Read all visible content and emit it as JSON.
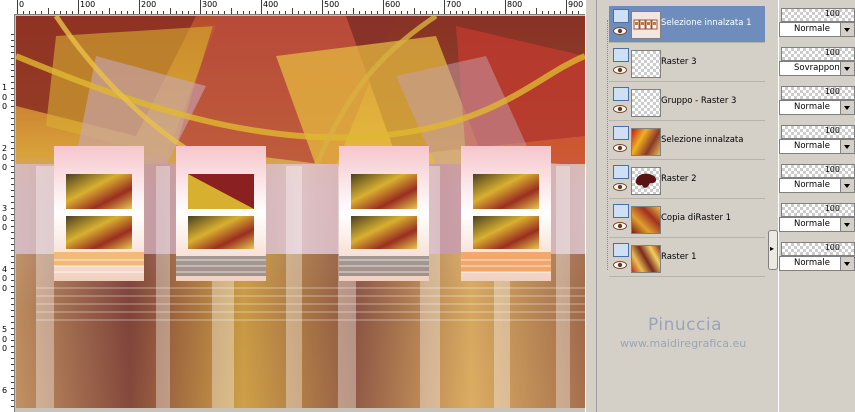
{
  "ruler": {
    "top_numbers": [
      "0",
      "100",
      "200",
      "300",
      "400",
      "500",
      "600",
      "700",
      "800",
      "900"
    ],
    "left_numbers": [
      "1",
      "0",
      "0",
      "2",
      "0",
      "0",
      "3",
      "0",
      "0",
      "4",
      "0",
      "0",
      "5",
      "0",
      "0",
      "6"
    ]
  },
  "layers": [
    {
      "name": "Selezione innalzata 1",
      "selected": true,
      "thumb": "t-sel1"
    },
    {
      "name": "Raster 3",
      "selected": false,
      "thumb": "t-empty"
    },
    {
      "name": "Gruppo - Raster 3",
      "selected": false,
      "thumb": "t-empty"
    },
    {
      "name": "Selezione innalzata",
      "selected": false,
      "thumb": "t-sel2"
    },
    {
      "name": "Raster 2",
      "selected": false,
      "thumb": "t-r2"
    },
    {
      "name": "Copia diRaster 1",
      "selected": false,
      "thumb": "t-copy"
    },
    {
      "name": "Raster 1",
      "selected": false,
      "thumb": "t-r1"
    }
  ],
  "properties": [
    {
      "opacity": "100",
      "blend_mode": "Normale"
    },
    {
      "opacity": "100",
      "blend_mode": "Sovrapponi"
    },
    {
      "opacity": "100",
      "blend_mode": "Normale"
    },
    {
      "opacity": "100",
      "blend_mode": "Normale"
    },
    {
      "opacity": "100",
      "blend_mode": "Normale"
    },
    {
      "opacity": "100",
      "blend_mode": "Normale"
    },
    {
      "opacity": "100",
      "blend_mode": "Normale"
    }
  ],
  "watermark": {
    "name": "Pinuccia",
    "site": "www.maidiregrafica.eu"
  },
  "colors": {
    "selected_row": "#6e8dbd",
    "panel_bg": "#d4d0c8",
    "watermark": "#9aa4b8"
  }
}
